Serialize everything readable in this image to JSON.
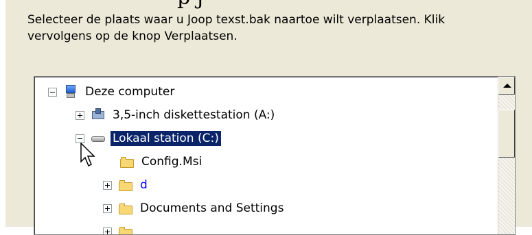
{
  "window": {
    "title_fragment": "p        j"
  },
  "dialog": {
    "instruction": "Selecteer de plaats waar u Joop texst.bak naartoe wilt verplaatsen. Klik vervolgens op de knop Verplaatsen."
  },
  "tree": {
    "items": [
      {
        "label": "Deze computer",
        "icon": "computer-icon",
        "expander": "minus",
        "selected": false
      },
      {
        "label": "3,5-inch diskettestation (A:)",
        "icon": "floppy-drive-icon",
        "expander": "plus",
        "selected": false
      },
      {
        "label": "Lokaal station (C:)",
        "icon": "hard-drive-icon",
        "expander": "minus",
        "selected": true
      },
      {
        "label": "Config.Msi",
        "icon": "folder-icon",
        "expander": "none",
        "selected": false
      },
      {
        "label": "d",
        "icon": "folder-icon",
        "expander": "plus",
        "selected": false
      },
      {
        "label": "Documents and Settings",
        "icon": "folder-icon",
        "expander": "plus",
        "selected": false
      }
    ]
  },
  "colors": {
    "dialog_bg": "#ece9d8",
    "selection_bg": "#0a246a",
    "link_blue": "#0000ff"
  }
}
